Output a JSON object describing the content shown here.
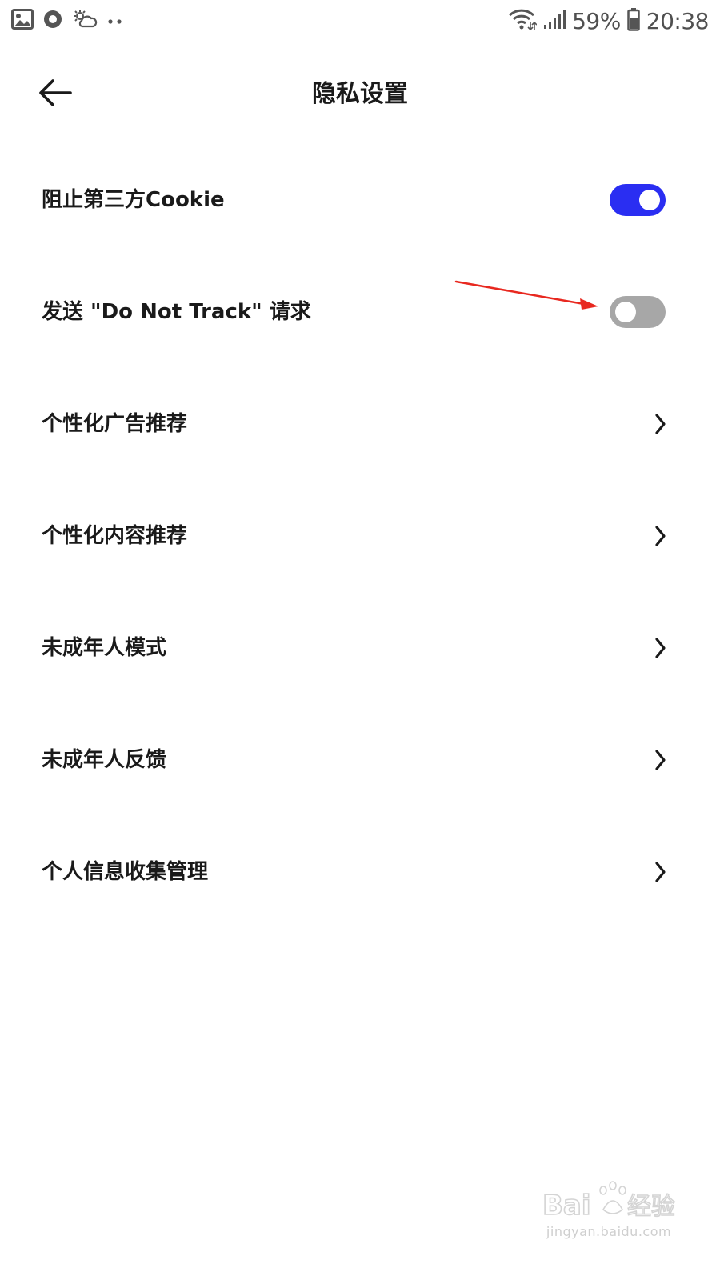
{
  "status_bar": {
    "left_icons": [
      "gallery-icon",
      "record-icon",
      "weather-icon",
      "more-dots-icon"
    ],
    "wifi_icon": "wifi-icon",
    "signal_icon": "signal-icon",
    "battery_percent": "59%",
    "battery_icon": "battery-icon",
    "time": "20:38"
  },
  "app_bar": {
    "back_icon": "back-arrow-icon",
    "title": "隐私设置"
  },
  "settings": {
    "items": [
      {
        "label": "阻止第三方Cookie",
        "control": "toggle",
        "checked": true
      },
      {
        "label": "发送 \"Do Not Track\" 请求",
        "control": "toggle",
        "checked": false
      },
      {
        "label": "个性化广告推荐",
        "control": "chevron"
      },
      {
        "label": "个性化内容推荐",
        "control": "chevron"
      },
      {
        "label": "未成年人模式",
        "control": "chevron"
      },
      {
        "label": "未成年人反馈",
        "control": "chevron"
      },
      {
        "label": "个人信息收集管理",
        "control": "chevron"
      }
    ]
  },
  "colors": {
    "toggle_on": "#2a2ef2",
    "toggle_off": "#a7a7a7",
    "annotation_arrow": "#e8281f",
    "text": "#1a1a1a"
  },
  "annotation": {
    "type": "arrow",
    "points_to": "settings.items.1"
  },
  "watermark": {
    "logo": "Bai du 经验",
    "url": "jingyan.baidu.com"
  }
}
